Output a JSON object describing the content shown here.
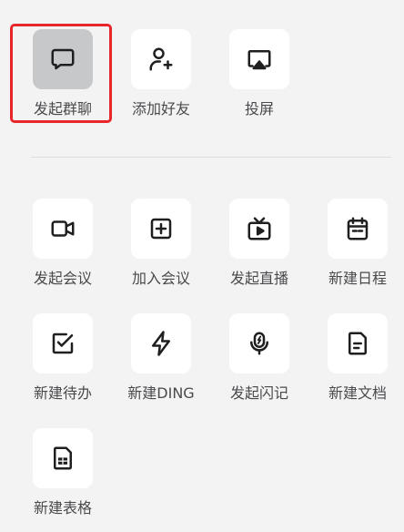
{
  "top_row": [
    {
      "label": "发起群聊",
      "icon": "chat-bubble-icon"
    },
    {
      "label": "添加好友",
      "icon": "add-user-icon"
    },
    {
      "label": "投屏",
      "icon": "screen-cast-icon"
    }
  ],
  "grid": [
    {
      "label": "发起会议",
      "icon": "video-camera-icon"
    },
    {
      "label": "加入会议",
      "icon": "plus-square-icon"
    },
    {
      "label": "发起直播",
      "icon": "live-tv-icon"
    },
    {
      "label": "新建日程",
      "icon": "calendar-icon"
    },
    {
      "label": "新建待办",
      "icon": "checkbox-icon"
    },
    {
      "label": "新建DING",
      "icon": "lightning-icon"
    },
    {
      "label": "发起闪记",
      "icon": "mic-flash-icon"
    },
    {
      "label": "新建文档",
      "icon": "document-icon"
    },
    {
      "label": "新建表格",
      "icon": "spreadsheet-icon"
    }
  ],
  "colors": {
    "highlight": "#e8262a",
    "active_tile": "#c7c8ca",
    "background": "#f3f3f4"
  }
}
